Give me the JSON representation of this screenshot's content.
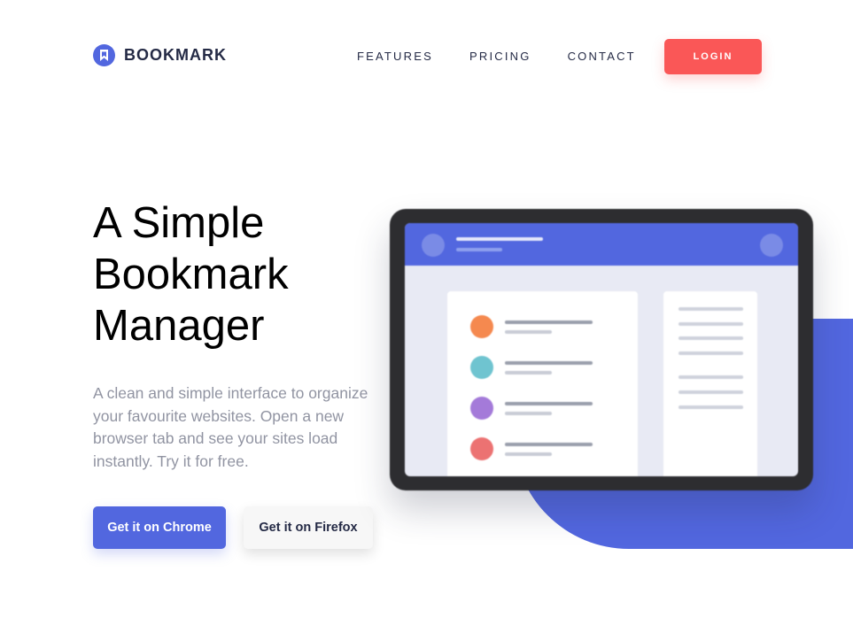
{
  "header": {
    "logo_text": "BOOKMARK",
    "logo_icon": "bookmark-icon",
    "nav": [
      {
        "label": "FEATURES"
      },
      {
        "label": "PRICING"
      },
      {
        "label": "CONTACT"
      }
    ],
    "login_label": "LOGIN"
  },
  "hero": {
    "title_lines": [
      "A Simple",
      "Bookmark",
      "Manager"
    ],
    "description": "A clean and simple interface to organize your favourite websites. Open a new browser tab and see your sites load instantly. Try it for free.",
    "cta_chrome": "Get it on Chrome",
    "cta_firefox": "Get it on Firefox"
  },
  "illustration": {
    "list_dot_colors": [
      "#f5894f",
      "#6fc4d0",
      "#a47ad9",
      "#ec7272"
    ]
  },
  "colors": {
    "accent_blue": "#5267df",
    "accent_red": "#fa5757",
    "dark_text": "#242a45",
    "muted_text": "#9194a2"
  }
}
